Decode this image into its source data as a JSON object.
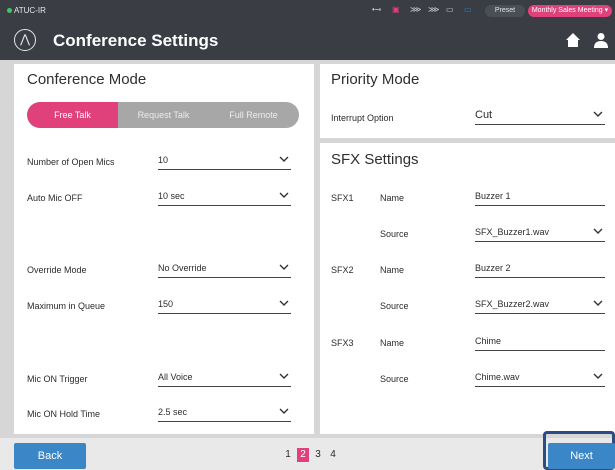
{
  "status_bar": {
    "app_name": "ATUC-IR",
    "preset_label": "Preset",
    "preset_name": "Monthly Sales Meeting"
  },
  "title_bar": {
    "title": "Conference Settings"
  },
  "conference_mode": {
    "title": "Conference Mode",
    "modes": [
      "Free Talk",
      "Request Talk",
      "Full Remote"
    ],
    "selected_mode": "Free Talk",
    "settings": [
      {
        "label": "Number of Open Mics",
        "value": "10"
      },
      {
        "label": "Auto Mic OFF",
        "value": "10 sec"
      },
      {
        "label": "Override Mode",
        "value": "No Override"
      },
      {
        "label": "Maximum in Queue",
        "value": "150"
      },
      {
        "label": "Mic ON Trigger",
        "value": "All Voice"
      },
      {
        "label": "Mic ON Hold Time",
        "value": "2.5 sec"
      }
    ]
  },
  "priority_mode": {
    "title": "Priority Mode",
    "interrupt_label": "Interrupt Option",
    "interrupt_value": "Cut"
  },
  "sfx_settings": {
    "title": "SFX Settings",
    "name_label": "Name",
    "source_label": "Source",
    "items": [
      {
        "id": "SFX1",
        "name": "Buzzer 1",
        "source": "SFX_Buzzer1.wav"
      },
      {
        "id": "SFX2",
        "name": "Buzzer 2",
        "source": "SFX_Buzzer2.wav"
      },
      {
        "id": "SFX3",
        "name": "Chime",
        "source": "Chime.wav"
      }
    ]
  },
  "footer": {
    "back_label": "Back",
    "next_label": "Next",
    "pages": [
      "1",
      "2",
      "3",
      "4"
    ],
    "current_page": "2"
  },
  "colors": {
    "accent": "#e0417a",
    "primary_button": "#3a86c6",
    "header": "#3a3d44"
  }
}
